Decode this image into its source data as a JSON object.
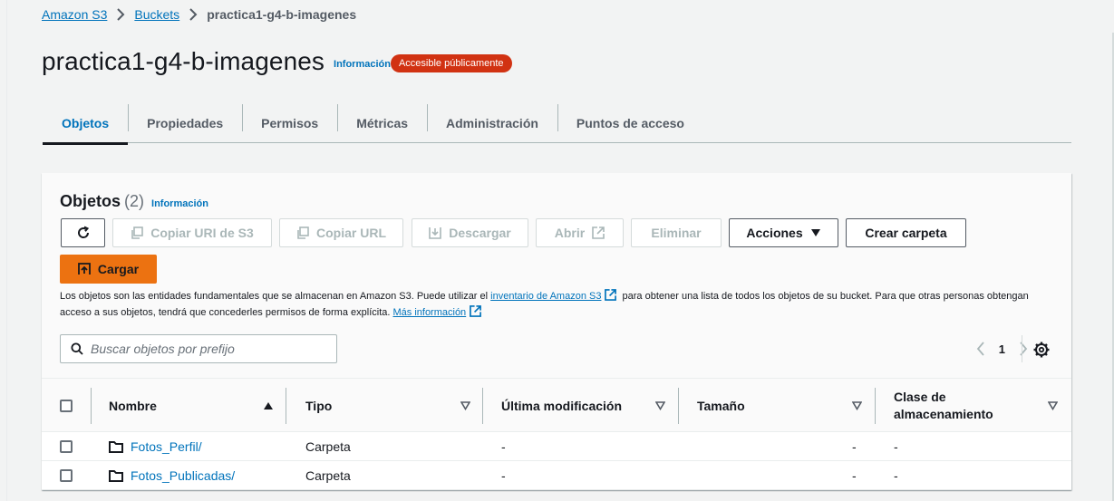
{
  "breadcrumb": {
    "items": [
      {
        "label": "Amazon S3"
      },
      {
        "label": "Buckets"
      },
      {
        "label": "practica1-g4-b-imagenes"
      }
    ]
  },
  "header": {
    "title": "practica1-g4-b-imagenes",
    "info_label": "Información",
    "badge_label": "Accesible públicamente",
    "badge_color": "#d13212"
  },
  "tabs": [
    {
      "label": "Objetos",
      "active": true
    },
    {
      "label": "Propiedades"
    },
    {
      "label": "Permisos"
    },
    {
      "label": "Métricas"
    },
    {
      "label": "Administración"
    },
    {
      "label": "Puntos de acceso"
    }
  ],
  "objects_panel": {
    "title": "Objetos",
    "count": "(2)",
    "info_label": "Información",
    "toolbar": {
      "refresh_icon": "refresh-icon",
      "copy_uri_label": "Copiar URI de S3",
      "copy_url_label": "Copiar URL",
      "download_label": "Descargar",
      "open_label": "Abrir",
      "delete_label": "Eliminar",
      "actions_label": "Acciones",
      "create_folder_label": "Crear carpeta",
      "upload_label": "Cargar",
      "upload_color": "#ec7211"
    },
    "description": {
      "text_1": "Los objetos son las entidades fundamentales que se almacenan en Amazon S3. Puede utilizar el ",
      "link_1": "inventario de Amazon S3",
      "text_2": " para obtener una lista de todos los objetos de su bucket. Para que otras personas obtengan acceso a sus objetos, tendrá que concederles permisos de forma explícita. ",
      "link_2": "Más información"
    },
    "search": {
      "placeholder": "Buscar objetos por prefijo",
      "value": ""
    },
    "pagination": {
      "current_page": "1"
    },
    "table": {
      "columns": {
        "name": "Nombre",
        "type": "Tipo",
        "modified": "Última modificación",
        "size": "Tamaño",
        "storage_class": "Clase de almacenamiento"
      },
      "rows": [
        {
          "name": "Fotos_Perfil/",
          "type": "Carpeta",
          "modified": "-",
          "size": "-",
          "storage_class": "-"
        },
        {
          "name": "Fotos_Publicadas/",
          "type": "Carpeta",
          "modified": "-",
          "size": "-",
          "storage_class": "-"
        }
      ]
    }
  },
  "colors": {
    "link": "#0073bb",
    "text": "#16191f",
    "page_bg": "#f2f3f3"
  }
}
